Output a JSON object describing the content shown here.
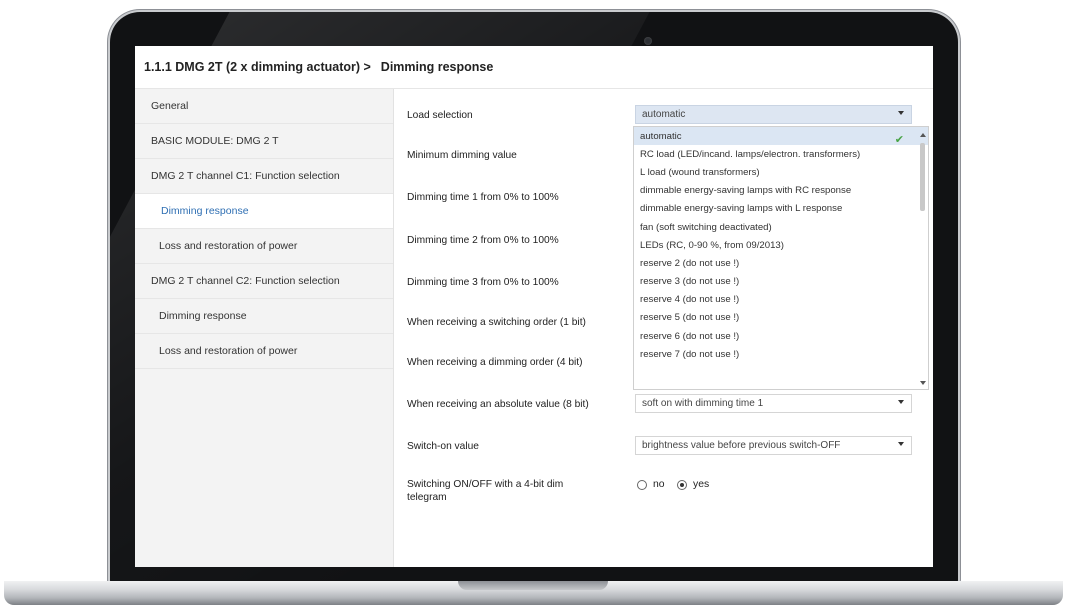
{
  "window": {
    "title_path": "1.1.1 DMG 2T (2 x dimming actuator) >",
    "title_page": "Dimming response"
  },
  "sidebar": {
    "items": [
      {
        "label": "General"
      },
      {
        "label": "BASIC MODULE: DMG 2 T"
      },
      {
        "label": "DMG 2 T channel C1: Function selection"
      },
      {
        "label": "Dimming response"
      },
      {
        "label": "Loss and restoration of power"
      },
      {
        "label": "DMG 2 T channel C2: Function selection"
      },
      {
        "label": "Dimming response"
      },
      {
        "label": "Loss and restoration of power"
      }
    ],
    "active_index": 3
  },
  "params": {
    "load_selection": {
      "label": "Load selection",
      "value": "automatic"
    },
    "min_dimming": {
      "label": "Minimum dimming value"
    },
    "dim_time_1": {
      "label": "Dimming time 1 from 0% to 100%"
    },
    "dim_time_2": {
      "label": "Dimming time 2 from 0% to 100%"
    },
    "dim_time_3": {
      "label": "Dimming time 3 from 0% to 100%"
    },
    "switching_order": {
      "label": "When receiving a switching order (1 bit)"
    },
    "dimming_order": {
      "label": "When receiving a dimming order (4 bit)"
    },
    "absolute_value": {
      "label": "When receiving an absolute value (8 bit)",
      "value": "soft on with dimming time 1"
    },
    "switch_on_value": {
      "label": "Switch-on value",
      "value": "brightness value before previous switch-OFF"
    },
    "switching_4bit": {
      "label_line1": "Switching ON/OFF with a 4-bit dim",
      "label_line2": "telegram",
      "option_no": "no",
      "option_yes": "yes",
      "selected": "yes"
    }
  },
  "dropdown": {
    "selected": "automatic",
    "options": [
      {
        "label": "automatic"
      },
      {
        "label": "RC load (LED/incand. lamps/electron. transformers)"
      },
      {
        "label": "L load (wound transformers)"
      },
      {
        "label": "dimmable energy-saving lamps with RC response"
      },
      {
        "label": "dimmable energy-saving lamps with L response"
      },
      {
        "label": "fan (soft switching deactivated)"
      },
      {
        "label": "LEDs (RC, 0-90 %, from 09/2013)"
      },
      {
        "label": "reserve 2 (do not use !)"
      },
      {
        "label": "reserve 3 (do not use !)"
      },
      {
        "label": "reserve 4 (do not use !)"
      },
      {
        "label": "reserve 5 (do not use !)"
      },
      {
        "label": "reserve 6 (do not use !)"
      },
      {
        "label": "reserve 7 (do not use !)"
      }
    ]
  },
  "colors": {
    "accent": "#2f6fb3",
    "check": "#47a345",
    "bezel": "#111214"
  }
}
